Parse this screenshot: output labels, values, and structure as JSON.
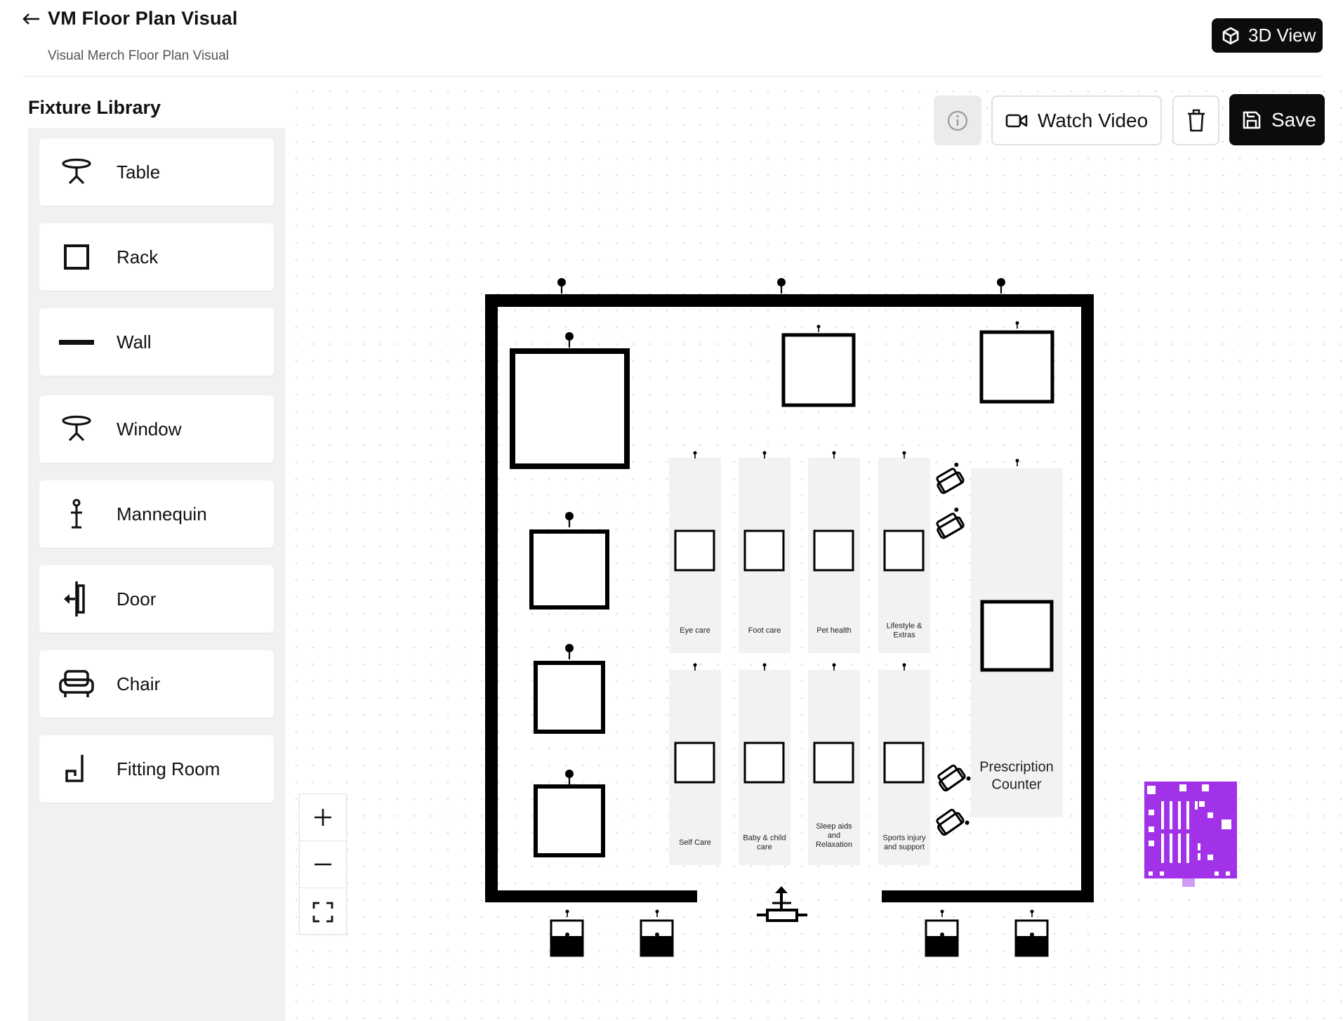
{
  "header": {
    "title": "VM Floor Plan Visual",
    "subtitle": "Visual Merch Floor Plan Visual",
    "back_icon": "arrow-left-icon",
    "view3d_label": "3D View",
    "view3d_icon": "cube-icon"
  },
  "library": {
    "title": "Fixture Library",
    "items": [
      {
        "label": "Table",
        "icon": "table-icon"
      },
      {
        "label": "Rack",
        "icon": "rack-icon"
      },
      {
        "label": "Wall",
        "icon": "wall-icon"
      },
      {
        "label": "Window",
        "icon": "window-icon"
      },
      {
        "label": "Mannequin",
        "icon": "mannequin-icon"
      },
      {
        "label": "Door",
        "icon": "door-icon"
      },
      {
        "label": "Chair",
        "icon": "chair-icon"
      },
      {
        "label": "Fitting Room",
        "icon": "fitting-room-icon"
      }
    ]
  },
  "toolbar": {
    "info_icon": "info-icon",
    "watch_video_label": "Watch Video",
    "watch_video_icon": "video-camera-icon",
    "delete_icon": "trash-icon",
    "save_label": "Save",
    "save_icon": "floppy-disk-icon"
  },
  "zoom": {
    "zoom_in_icon": "plus-icon",
    "zoom_out_icon": "minus-icon",
    "fit_icon": "fullscreen-icon"
  },
  "floorplan": {
    "aisle_labels_top": [
      "Eye care",
      "Foot care",
      "Pet health",
      "Lifestyle &\nExtras"
    ],
    "aisle_labels_bottom": [
      "Self Care",
      "Baby & child\ncare",
      "Sleep aids\nand\nRelaxation",
      "Sports injury\nand support"
    ],
    "counter_label": "Prescription\nCounter",
    "colors": {
      "wall": "#000000",
      "aisle_fill": "#f2f2f2",
      "minimap": "#a132e8"
    }
  }
}
